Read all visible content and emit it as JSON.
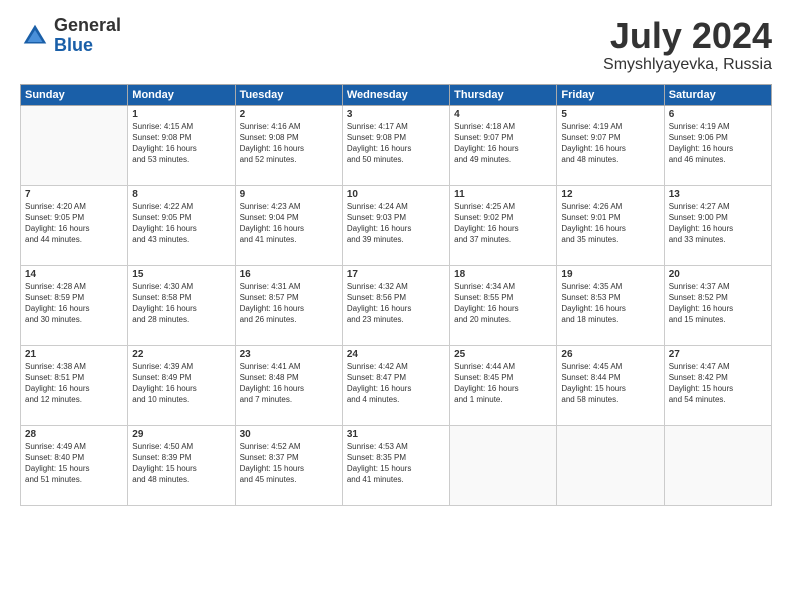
{
  "header": {
    "logo_general": "General",
    "logo_blue": "Blue",
    "title": "July 2024",
    "subtitle": "Smyshlyayevka, Russia"
  },
  "calendar": {
    "days_of_week": [
      "Sunday",
      "Monday",
      "Tuesday",
      "Wednesday",
      "Thursday",
      "Friday",
      "Saturday"
    ],
    "weeks": [
      [
        {
          "day": "",
          "info": ""
        },
        {
          "day": "1",
          "info": "Sunrise: 4:15 AM\nSunset: 9:08 PM\nDaylight: 16 hours\nand 53 minutes."
        },
        {
          "day": "2",
          "info": "Sunrise: 4:16 AM\nSunset: 9:08 PM\nDaylight: 16 hours\nand 52 minutes."
        },
        {
          "day": "3",
          "info": "Sunrise: 4:17 AM\nSunset: 9:08 PM\nDaylight: 16 hours\nand 50 minutes."
        },
        {
          "day": "4",
          "info": "Sunrise: 4:18 AM\nSunset: 9:07 PM\nDaylight: 16 hours\nand 49 minutes."
        },
        {
          "day": "5",
          "info": "Sunrise: 4:19 AM\nSunset: 9:07 PM\nDaylight: 16 hours\nand 48 minutes."
        },
        {
          "day": "6",
          "info": "Sunrise: 4:19 AM\nSunset: 9:06 PM\nDaylight: 16 hours\nand 46 minutes."
        }
      ],
      [
        {
          "day": "7",
          "info": "Sunrise: 4:20 AM\nSunset: 9:05 PM\nDaylight: 16 hours\nand 44 minutes."
        },
        {
          "day": "8",
          "info": "Sunrise: 4:22 AM\nSunset: 9:05 PM\nDaylight: 16 hours\nand 43 minutes."
        },
        {
          "day": "9",
          "info": "Sunrise: 4:23 AM\nSunset: 9:04 PM\nDaylight: 16 hours\nand 41 minutes."
        },
        {
          "day": "10",
          "info": "Sunrise: 4:24 AM\nSunset: 9:03 PM\nDaylight: 16 hours\nand 39 minutes."
        },
        {
          "day": "11",
          "info": "Sunrise: 4:25 AM\nSunset: 9:02 PM\nDaylight: 16 hours\nand 37 minutes."
        },
        {
          "day": "12",
          "info": "Sunrise: 4:26 AM\nSunset: 9:01 PM\nDaylight: 16 hours\nand 35 minutes."
        },
        {
          "day": "13",
          "info": "Sunrise: 4:27 AM\nSunset: 9:00 PM\nDaylight: 16 hours\nand 33 minutes."
        }
      ],
      [
        {
          "day": "14",
          "info": "Sunrise: 4:28 AM\nSunset: 8:59 PM\nDaylight: 16 hours\nand 30 minutes."
        },
        {
          "day": "15",
          "info": "Sunrise: 4:30 AM\nSunset: 8:58 PM\nDaylight: 16 hours\nand 28 minutes."
        },
        {
          "day": "16",
          "info": "Sunrise: 4:31 AM\nSunset: 8:57 PM\nDaylight: 16 hours\nand 26 minutes."
        },
        {
          "day": "17",
          "info": "Sunrise: 4:32 AM\nSunset: 8:56 PM\nDaylight: 16 hours\nand 23 minutes."
        },
        {
          "day": "18",
          "info": "Sunrise: 4:34 AM\nSunset: 8:55 PM\nDaylight: 16 hours\nand 20 minutes."
        },
        {
          "day": "19",
          "info": "Sunrise: 4:35 AM\nSunset: 8:53 PM\nDaylight: 16 hours\nand 18 minutes."
        },
        {
          "day": "20",
          "info": "Sunrise: 4:37 AM\nSunset: 8:52 PM\nDaylight: 16 hours\nand 15 minutes."
        }
      ],
      [
        {
          "day": "21",
          "info": "Sunrise: 4:38 AM\nSunset: 8:51 PM\nDaylight: 16 hours\nand 12 minutes."
        },
        {
          "day": "22",
          "info": "Sunrise: 4:39 AM\nSunset: 8:49 PM\nDaylight: 16 hours\nand 10 minutes."
        },
        {
          "day": "23",
          "info": "Sunrise: 4:41 AM\nSunset: 8:48 PM\nDaylight: 16 hours\nand 7 minutes."
        },
        {
          "day": "24",
          "info": "Sunrise: 4:42 AM\nSunset: 8:47 PM\nDaylight: 16 hours\nand 4 minutes."
        },
        {
          "day": "25",
          "info": "Sunrise: 4:44 AM\nSunset: 8:45 PM\nDaylight: 16 hours\nand 1 minute."
        },
        {
          "day": "26",
          "info": "Sunrise: 4:45 AM\nSunset: 8:44 PM\nDaylight: 15 hours\nand 58 minutes."
        },
        {
          "day": "27",
          "info": "Sunrise: 4:47 AM\nSunset: 8:42 PM\nDaylight: 15 hours\nand 54 minutes."
        }
      ],
      [
        {
          "day": "28",
          "info": "Sunrise: 4:49 AM\nSunset: 8:40 PM\nDaylight: 15 hours\nand 51 minutes."
        },
        {
          "day": "29",
          "info": "Sunrise: 4:50 AM\nSunset: 8:39 PM\nDaylight: 15 hours\nand 48 minutes."
        },
        {
          "day": "30",
          "info": "Sunrise: 4:52 AM\nSunset: 8:37 PM\nDaylight: 15 hours\nand 45 minutes."
        },
        {
          "day": "31",
          "info": "Sunrise: 4:53 AM\nSunset: 8:35 PM\nDaylight: 15 hours\nand 41 minutes."
        },
        {
          "day": "",
          "info": ""
        },
        {
          "day": "",
          "info": ""
        },
        {
          "day": "",
          "info": ""
        }
      ]
    ]
  }
}
